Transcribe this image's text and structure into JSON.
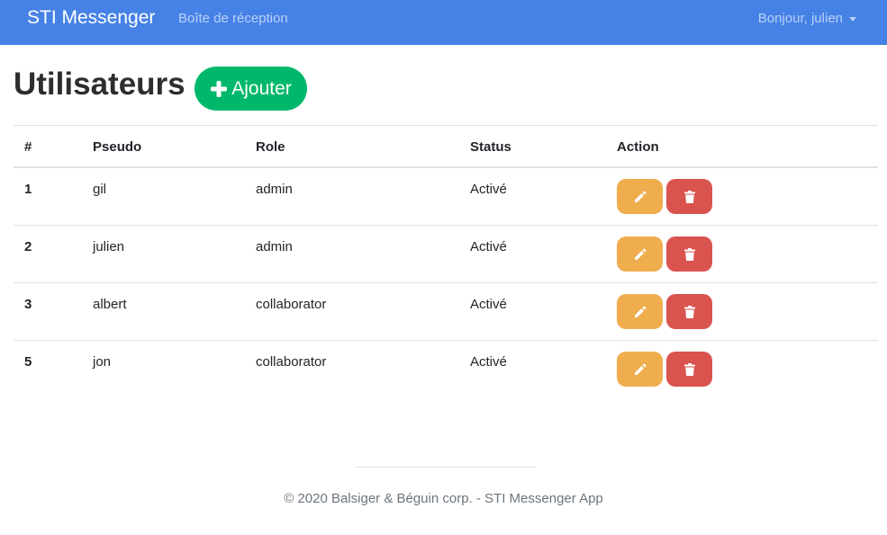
{
  "navbar": {
    "brand": "STI Messenger",
    "inbox_link": "Boîte de réception",
    "user_menu": "Bonjour, julien"
  },
  "page": {
    "title": "Utilisateurs",
    "add_button": "Ajouter"
  },
  "table": {
    "headers": {
      "id": "#",
      "pseudo": "Pseudo",
      "role": "Role",
      "status": "Status",
      "action": "Action"
    },
    "rows": [
      {
        "id": "1",
        "pseudo": "gil",
        "role": "admin",
        "status": "Activé"
      },
      {
        "id": "2",
        "pseudo": "julien",
        "role": "admin",
        "status": "Activé"
      },
      {
        "id": "3",
        "pseudo": "albert",
        "role": "collaborator",
        "status": "Activé"
      },
      {
        "id": "5",
        "pseudo": "jon",
        "role": "collaborator",
        "status": "Activé"
      }
    ]
  },
  "icons": {
    "add": "plus-icon",
    "edit": "pencil-icon",
    "delete": "trash-icon",
    "dropdown": "caret-down-icon"
  },
  "colors": {
    "navbar": "#4682e6",
    "add_button": "#00b86b",
    "edit_button": "#f0ad4e",
    "delete_button": "#d9534f"
  },
  "footer": {
    "text": "© 2020 Balsiger & Béguin corp. - STI Messenger App"
  }
}
